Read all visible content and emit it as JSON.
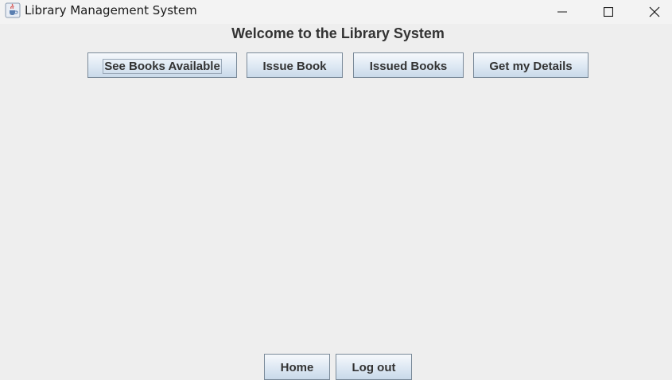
{
  "window": {
    "title": "Library Management System",
    "icon": "java-coffee-cup-icon",
    "controls": [
      "minimize-icon",
      "maximize-icon",
      "close-icon"
    ]
  },
  "main": {
    "heading": "Welcome to the Library System",
    "nav_buttons": [
      {
        "label": "See Books Available",
        "focused": true
      },
      {
        "label": "Issue Book"
      },
      {
        "label": "Issued Books"
      },
      {
        "label": "Get my Details"
      }
    ]
  },
  "footer": {
    "home_label": "Home",
    "logout_label": "Log out"
  },
  "colors": {
    "background": "#eeeeee",
    "button_top": "#f6f9fc",
    "button_bottom": "#c9d9e9",
    "button_border": "#7a8a99",
    "text": "#333333"
  }
}
